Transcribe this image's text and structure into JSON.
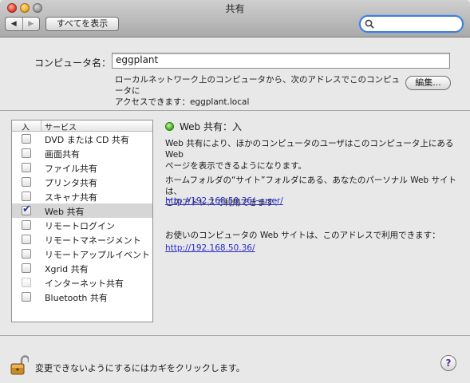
{
  "window": {
    "title": "共有"
  },
  "toolbar": {
    "back_glyph": "◀",
    "forward_glyph": "▶",
    "show_all_label": "すべてを表示",
    "search_placeholder": ""
  },
  "computer": {
    "label": "コンピュータ名：",
    "name_value": "eggplant",
    "info_line1": "ローカルネットワーク上のコンピュータから、次のアドレスでこのコンピュータに",
    "info_line2": "アクセスできます：eggplant.local",
    "edit_label": "編集..."
  },
  "services": {
    "header_on": "入",
    "header_service": "サービス",
    "items": [
      {
        "label": "DVD または CD 共有",
        "checked": false,
        "selected": false,
        "enabled": true
      },
      {
        "label": "画面共有",
        "checked": false,
        "selected": false,
        "enabled": true
      },
      {
        "label": "ファイル共有",
        "checked": false,
        "selected": false,
        "enabled": true
      },
      {
        "label": "プリンタ共有",
        "checked": false,
        "selected": false,
        "enabled": true
      },
      {
        "label": "スキャナ共有",
        "checked": false,
        "selected": false,
        "enabled": true
      },
      {
        "label": "Web 共有",
        "checked": true,
        "selected": true,
        "enabled": true
      },
      {
        "label": "リモートログイン",
        "checked": false,
        "selected": false,
        "enabled": true
      },
      {
        "label": "リモートマネージメント",
        "checked": false,
        "selected": false,
        "enabled": true
      },
      {
        "label": "リモートアップルイベント",
        "checked": false,
        "selected": false,
        "enabled": true
      },
      {
        "label": "Xgrid 共有",
        "checked": false,
        "selected": false,
        "enabled": true
      },
      {
        "label": "インターネット共有",
        "checked": false,
        "selected": false,
        "enabled": false
      },
      {
        "label": "Bluetooth 共有",
        "checked": false,
        "selected": false,
        "enabled": true
      }
    ]
  },
  "detail": {
    "status": "Web 共有：入",
    "status_color": "#3fa71a",
    "desc1_line1": "Web 共有により、ほかのコンピュータのユーザはこのコンピュータ上にある Web",
    "desc1_line2": "ページを表示できるようになります。",
    "desc2_line1": "ホームフォルダの“サイト”フォルダにある、あなたのパーソナル Web サイトは、",
    "desc2_line2": "このアドレスで利用できます：",
    "link1": "http://192.168.50.36/~user/",
    "desc3": "お使いのコンピュータの Web サイトは、このアドレスで利用できます：",
    "link2": "http://192.168.50.36/"
  },
  "footer": {
    "lock_text": "変更できないようにするにはカギをクリックします。",
    "help_label": "?"
  },
  "colors": {
    "link": "#2a2ad0",
    "search_focus": "#3f7ed8",
    "check": "#1b3f9a"
  }
}
